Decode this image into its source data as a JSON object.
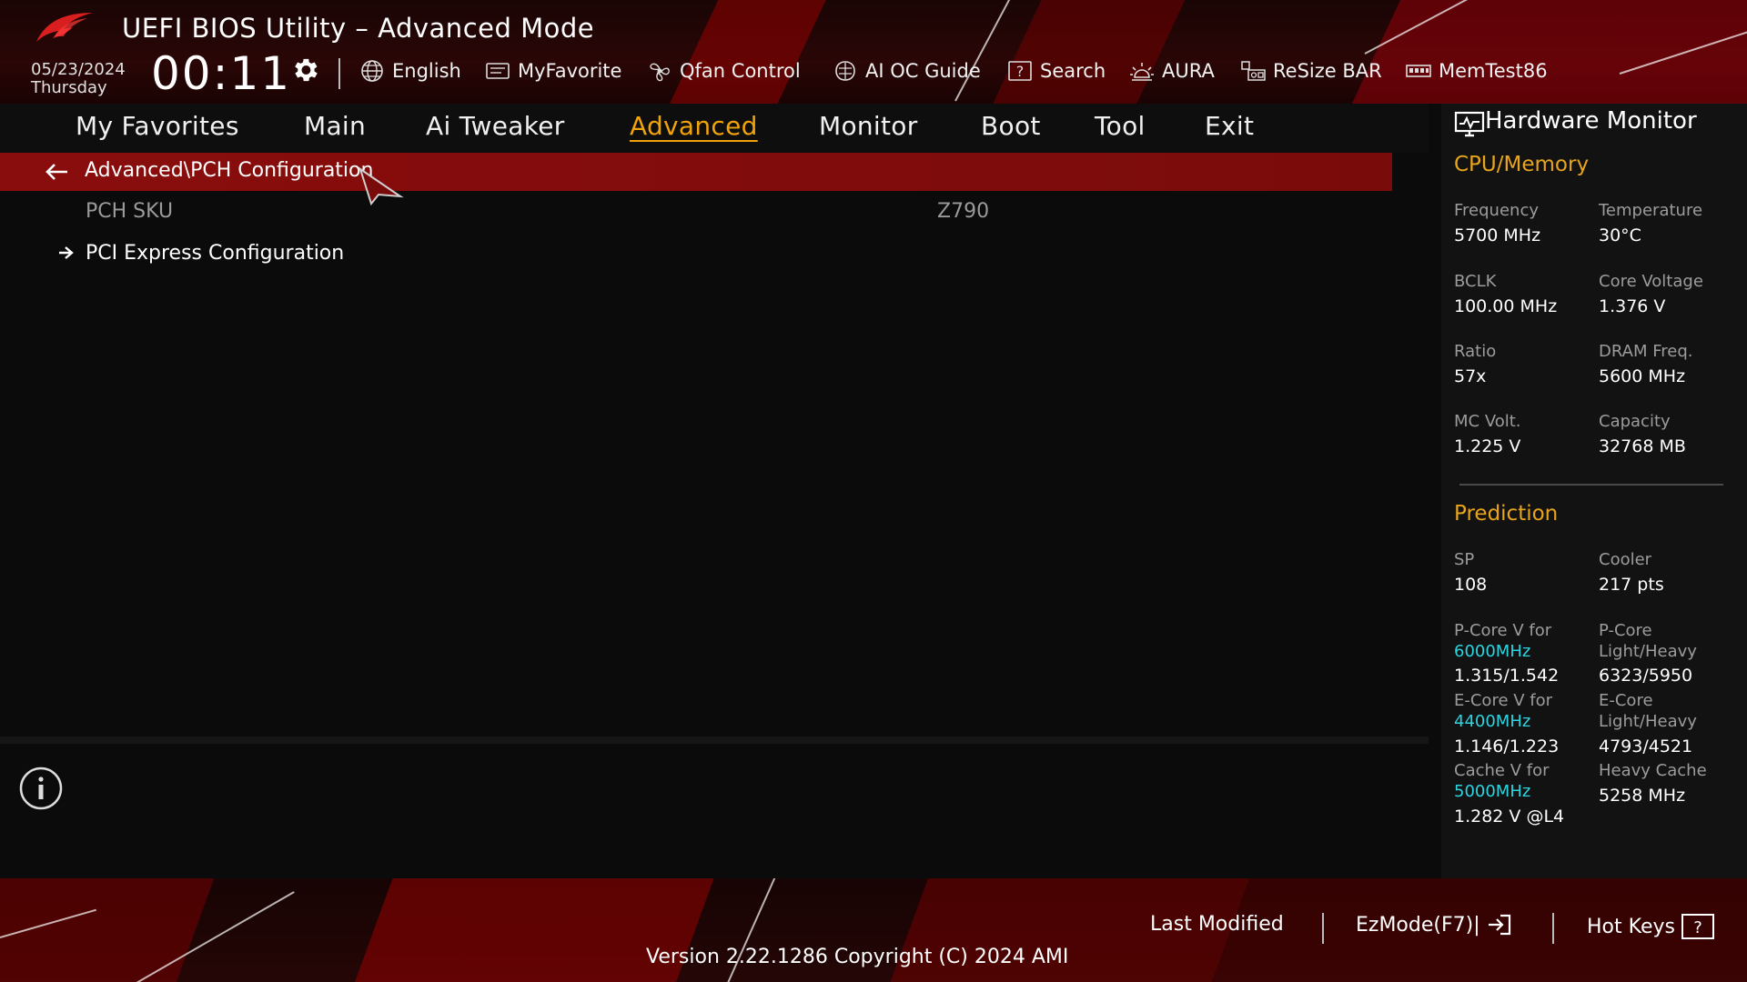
{
  "header": {
    "title": "UEFI BIOS Utility – Advanced Mode",
    "date": "05/23/2024",
    "day": "Thursday",
    "time": "00:11",
    "tools": [
      {
        "label": "English",
        "icon": "globe-icon"
      },
      {
        "label": "MyFavorite",
        "icon": "myfavorite-icon"
      },
      {
        "label": "Qfan Control",
        "icon": "fan-icon"
      },
      {
        "label": "AI OC Guide",
        "icon": "ai-oc-guide-icon"
      },
      {
        "label": "Search",
        "icon": "search-help-icon"
      },
      {
        "label": "AURA",
        "icon": "aura-icon"
      },
      {
        "label": "ReSize BAR",
        "icon": "resize-bar-icon"
      },
      {
        "label": "MemTest86",
        "icon": "memtest-icon"
      }
    ]
  },
  "tabs": [
    {
      "label": "My Favorites",
      "active": false
    },
    {
      "label": "Main",
      "active": false
    },
    {
      "label": "Ai Tweaker",
      "active": false
    },
    {
      "label": "Advanced",
      "active": true
    },
    {
      "label": "Monitor",
      "active": false
    },
    {
      "label": "Boot",
      "active": false
    },
    {
      "label": "Tool",
      "active": false
    },
    {
      "label": "Exit",
      "active": false
    }
  ],
  "main": {
    "path": "Advanced\\PCH Configuration",
    "rows": [
      {
        "label": "PCH SKU",
        "value": "Z790"
      },
      {
        "label": "PCI Express Configuration"
      }
    ]
  },
  "hardware_monitor": {
    "title": "Hardware Monitor",
    "cpu_memory": {
      "title": "CPU/Memory",
      "items": [
        {
          "label": "Frequency",
          "value": "5700 MHz"
        },
        {
          "label": "Temperature",
          "value": "30°C"
        },
        {
          "label": "BCLK",
          "value": "100.00 MHz"
        },
        {
          "label": "Core Voltage",
          "value": "1.376 V"
        },
        {
          "label": "Ratio",
          "value": "57x"
        },
        {
          "label": "DRAM Freq.",
          "value": "5600 MHz"
        },
        {
          "label": "MC Volt.",
          "value": "1.225 V"
        },
        {
          "label": "Capacity",
          "value": "32768 MB"
        }
      ]
    },
    "prediction": {
      "title": "Prediction",
      "sp_label": "SP",
      "sp_value": "108",
      "cooler_label": "Cooler",
      "cooler_value": "217 pts",
      "pcore_v_label": "P-Core V for",
      "pcore_v_freq": "6000MHz",
      "pcore_v_value": "1.315/1.542",
      "pcore_lh_label1": "P-Core",
      "pcore_lh_label2": "Light/Heavy",
      "pcore_lh_value": "6323/5950",
      "ecore_v_label": "E-Core V for",
      "ecore_v_freq": "4400MHz",
      "ecore_v_value": "1.146/1.223",
      "ecore_lh_label1": "E-Core",
      "ecore_lh_label2": "Light/Heavy",
      "ecore_lh_value": "4793/4521",
      "cache_v_label": "Cache V for",
      "cache_v_freq": "5000MHz",
      "cache_v_value": "1.282 V @L4",
      "heavy_cache_label": "Heavy Cache",
      "heavy_cache_value": "5258 MHz"
    }
  },
  "footer": {
    "last_modified": "Last Modified",
    "ezmode": "EzMode(F7)|",
    "hot_keys": "Hot Keys",
    "version": "Version 2.22.1286 Copyright (C) 2024 AMI"
  },
  "colors": {
    "accent": "#f0a30a",
    "path_bar": "#8a0d0d",
    "cyan": "#2dd4e0",
    "section": "#e8a51c"
  }
}
